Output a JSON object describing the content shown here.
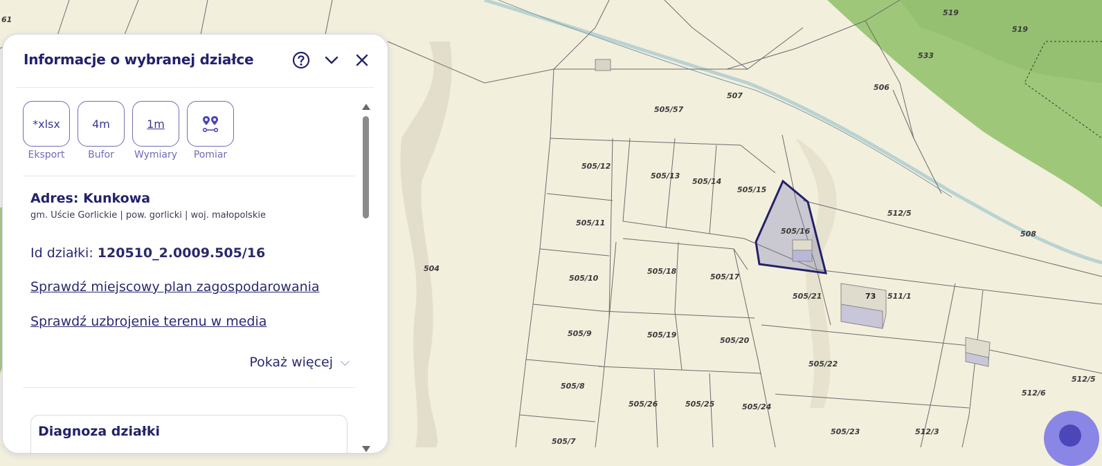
{
  "panel": {
    "title": "Informacje o wybranej działce",
    "tools": [
      {
        "label": "Eksport",
        "button_text": "*xlsx",
        "icon": "export-xlsx-icon"
      },
      {
        "label": "Bufor",
        "button_text": "4m",
        "icon": "buffer-icon"
      },
      {
        "label": "Wymiary",
        "button_text": "1m",
        "icon": "dimensions-icon"
      },
      {
        "label": "Pomiar",
        "button_text": "",
        "icon": "measure-pins-icon"
      }
    ],
    "address_title": "Adres: Kunkowa",
    "address_sub": "gm. Uście Gorlickie | pow. gorlicki | woj. małopolskie",
    "plot_id_label": "Id działki: ",
    "plot_id_value": "120510_2.0009.505/16",
    "link_plan": "Sprawdź miejscowy plan zagospodarowania",
    "link_media": "Sprawdź uzbrojenie terenu w media",
    "show_more": "Pokaż więcej",
    "diagnosis_title": "Diagnoza działki"
  },
  "map": {
    "selected_plot": "505/16",
    "selection_color": "#23216a",
    "plot_labels": [
      "61",
      "519",
      "519",
      "533",
      "506",
      "507",
      "505/57",
      "505/12",
      "505/13",
      "505/14",
      "505/15",
      "505/16",
      "512/5",
      "508",
      "505/11",
      "504",
      "505/10",
      "505/18",
      "505/17",
      "505/21",
      "73",
      "511/1",
      "505/9",
      "505/19",
      "505/20",
      "505/22",
      "505/8",
      "505/26",
      "505/25",
      "505/24",
      "512/6",
      "512/5",
      "505/7",
      "505/23",
      "512/3"
    ]
  }
}
